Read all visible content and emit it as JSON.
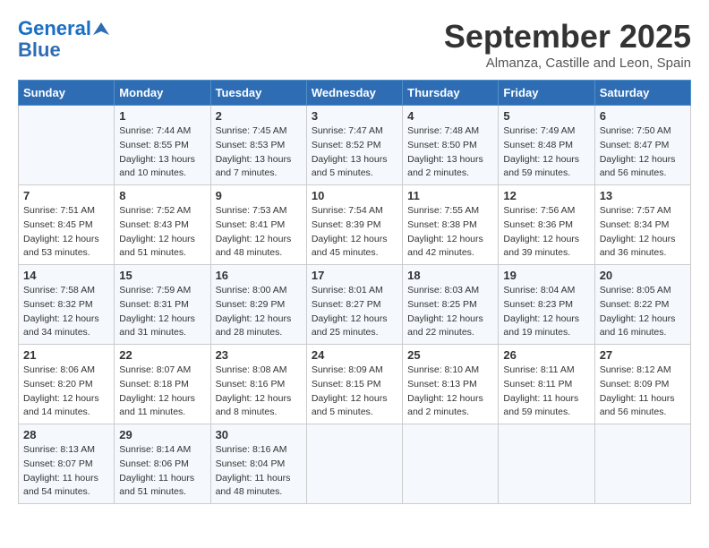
{
  "header": {
    "logo_line1": "General",
    "logo_line2": "Blue",
    "month_title": "September 2025",
    "location": "Almanza, Castille and Leon, Spain"
  },
  "days_of_week": [
    "Sunday",
    "Monday",
    "Tuesday",
    "Wednesday",
    "Thursday",
    "Friday",
    "Saturday"
  ],
  "weeks": [
    [
      {
        "day": "",
        "sunrise": "",
        "sunset": "",
        "daylight": ""
      },
      {
        "day": "1",
        "sunrise": "Sunrise: 7:44 AM",
        "sunset": "Sunset: 8:55 PM",
        "daylight": "Daylight: 13 hours and 10 minutes."
      },
      {
        "day": "2",
        "sunrise": "Sunrise: 7:45 AM",
        "sunset": "Sunset: 8:53 PM",
        "daylight": "Daylight: 13 hours and 7 minutes."
      },
      {
        "day": "3",
        "sunrise": "Sunrise: 7:47 AM",
        "sunset": "Sunset: 8:52 PM",
        "daylight": "Daylight: 13 hours and 5 minutes."
      },
      {
        "day": "4",
        "sunrise": "Sunrise: 7:48 AM",
        "sunset": "Sunset: 8:50 PM",
        "daylight": "Daylight: 13 hours and 2 minutes."
      },
      {
        "day": "5",
        "sunrise": "Sunrise: 7:49 AM",
        "sunset": "Sunset: 8:48 PM",
        "daylight": "Daylight: 12 hours and 59 minutes."
      },
      {
        "day": "6",
        "sunrise": "Sunrise: 7:50 AM",
        "sunset": "Sunset: 8:47 PM",
        "daylight": "Daylight: 12 hours and 56 minutes."
      }
    ],
    [
      {
        "day": "7",
        "sunrise": "Sunrise: 7:51 AM",
        "sunset": "Sunset: 8:45 PM",
        "daylight": "Daylight: 12 hours and 53 minutes."
      },
      {
        "day": "8",
        "sunrise": "Sunrise: 7:52 AM",
        "sunset": "Sunset: 8:43 PM",
        "daylight": "Daylight: 12 hours and 51 minutes."
      },
      {
        "day": "9",
        "sunrise": "Sunrise: 7:53 AM",
        "sunset": "Sunset: 8:41 PM",
        "daylight": "Daylight: 12 hours and 48 minutes."
      },
      {
        "day": "10",
        "sunrise": "Sunrise: 7:54 AM",
        "sunset": "Sunset: 8:39 PM",
        "daylight": "Daylight: 12 hours and 45 minutes."
      },
      {
        "day": "11",
        "sunrise": "Sunrise: 7:55 AM",
        "sunset": "Sunset: 8:38 PM",
        "daylight": "Daylight: 12 hours and 42 minutes."
      },
      {
        "day": "12",
        "sunrise": "Sunrise: 7:56 AM",
        "sunset": "Sunset: 8:36 PM",
        "daylight": "Daylight: 12 hours and 39 minutes."
      },
      {
        "day": "13",
        "sunrise": "Sunrise: 7:57 AM",
        "sunset": "Sunset: 8:34 PM",
        "daylight": "Daylight: 12 hours and 36 minutes."
      }
    ],
    [
      {
        "day": "14",
        "sunrise": "Sunrise: 7:58 AM",
        "sunset": "Sunset: 8:32 PM",
        "daylight": "Daylight: 12 hours and 34 minutes."
      },
      {
        "day": "15",
        "sunrise": "Sunrise: 7:59 AM",
        "sunset": "Sunset: 8:31 PM",
        "daylight": "Daylight: 12 hours and 31 minutes."
      },
      {
        "day": "16",
        "sunrise": "Sunrise: 8:00 AM",
        "sunset": "Sunset: 8:29 PM",
        "daylight": "Daylight: 12 hours and 28 minutes."
      },
      {
        "day": "17",
        "sunrise": "Sunrise: 8:01 AM",
        "sunset": "Sunset: 8:27 PM",
        "daylight": "Daylight: 12 hours and 25 minutes."
      },
      {
        "day": "18",
        "sunrise": "Sunrise: 8:03 AM",
        "sunset": "Sunset: 8:25 PM",
        "daylight": "Daylight: 12 hours and 22 minutes."
      },
      {
        "day": "19",
        "sunrise": "Sunrise: 8:04 AM",
        "sunset": "Sunset: 8:23 PM",
        "daylight": "Daylight: 12 hours and 19 minutes."
      },
      {
        "day": "20",
        "sunrise": "Sunrise: 8:05 AM",
        "sunset": "Sunset: 8:22 PM",
        "daylight": "Daylight: 12 hours and 16 minutes."
      }
    ],
    [
      {
        "day": "21",
        "sunrise": "Sunrise: 8:06 AM",
        "sunset": "Sunset: 8:20 PM",
        "daylight": "Daylight: 12 hours and 14 minutes."
      },
      {
        "day": "22",
        "sunrise": "Sunrise: 8:07 AM",
        "sunset": "Sunset: 8:18 PM",
        "daylight": "Daylight: 12 hours and 11 minutes."
      },
      {
        "day": "23",
        "sunrise": "Sunrise: 8:08 AM",
        "sunset": "Sunset: 8:16 PM",
        "daylight": "Daylight: 12 hours and 8 minutes."
      },
      {
        "day": "24",
        "sunrise": "Sunrise: 8:09 AM",
        "sunset": "Sunset: 8:15 PM",
        "daylight": "Daylight: 12 hours and 5 minutes."
      },
      {
        "day": "25",
        "sunrise": "Sunrise: 8:10 AM",
        "sunset": "Sunset: 8:13 PM",
        "daylight": "Daylight: 12 hours and 2 minutes."
      },
      {
        "day": "26",
        "sunrise": "Sunrise: 8:11 AM",
        "sunset": "Sunset: 8:11 PM",
        "daylight": "Daylight: 11 hours and 59 minutes."
      },
      {
        "day": "27",
        "sunrise": "Sunrise: 8:12 AM",
        "sunset": "Sunset: 8:09 PM",
        "daylight": "Daylight: 11 hours and 56 minutes."
      }
    ],
    [
      {
        "day": "28",
        "sunrise": "Sunrise: 8:13 AM",
        "sunset": "Sunset: 8:07 PM",
        "daylight": "Daylight: 11 hours and 54 minutes."
      },
      {
        "day": "29",
        "sunrise": "Sunrise: 8:14 AM",
        "sunset": "Sunset: 8:06 PM",
        "daylight": "Daylight: 11 hours and 51 minutes."
      },
      {
        "day": "30",
        "sunrise": "Sunrise: 8:16 AM",
        "sunset": "Sunset: 8:04 PM",
        "daylight": "Daylight: 11 hours and 48 minutes."
      },
      {
        "day": "",
        "sunrise": "",
        "sunset": "",
        "daylight": ""
      },
      {
        "day": "",
        "sunrise": "",
        "sunset": "",
        "daylight": ""
      },
      {
        "day": "",
        "sunrise": "",
        "sunset": "",
        "daylight": ""
      },
      {
        "day": "",
        "sunrise": "",
        "sunset": "",
        "daylight": ""
      }
    ]
  ]
}
